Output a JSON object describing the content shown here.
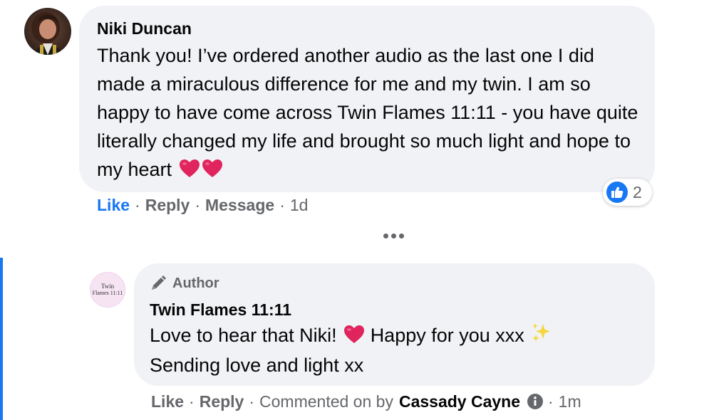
{
  "comment": {
    "author": "Niki Duncan",
    "text": "Thank you! I’ve ordered another audio as the last one I did made a miraculous difference for me and my twin. I am so happy to have come across Twin Flames 11:11 - you have quite literally changed my life and brought so much light and hope to my heart",
    "emoji": [
      "red-heart",
      "red-heart"
    ],
    "reaction_count": "2",
    "actions": {
      "like": "Like",
      "reply": "Reply",
      "message": "Message",
      "time": "1d"
    }
  },
  "reply": {
    "badge": "Author",
    "avatar_line1": "Twin",
    "avatar_line2": "Flames 11:11",
    "author": "Twin Flames 11:11",
    "text_part1": "Love to hear that Niki!",
    "text_part2": "Happy for you xxx",
    "text_line2": "Sending love and light xx",
    "emoji": [
      "red-heart",
      "sparkles"
    ],
    "actions": {
      "like": "Like",
      "reply": "Reply",
      "commented_on_by": "Commented on by",
      "commenter": "Cassady Cayne",
      "time": "1m"
    }
  },
  "colors": {
    "bubble": "#f0f2f5",
    "accent": "#1877f2",
    "secondary_text": "#65676b",
    "heart": "#e0245e"
  }
}
